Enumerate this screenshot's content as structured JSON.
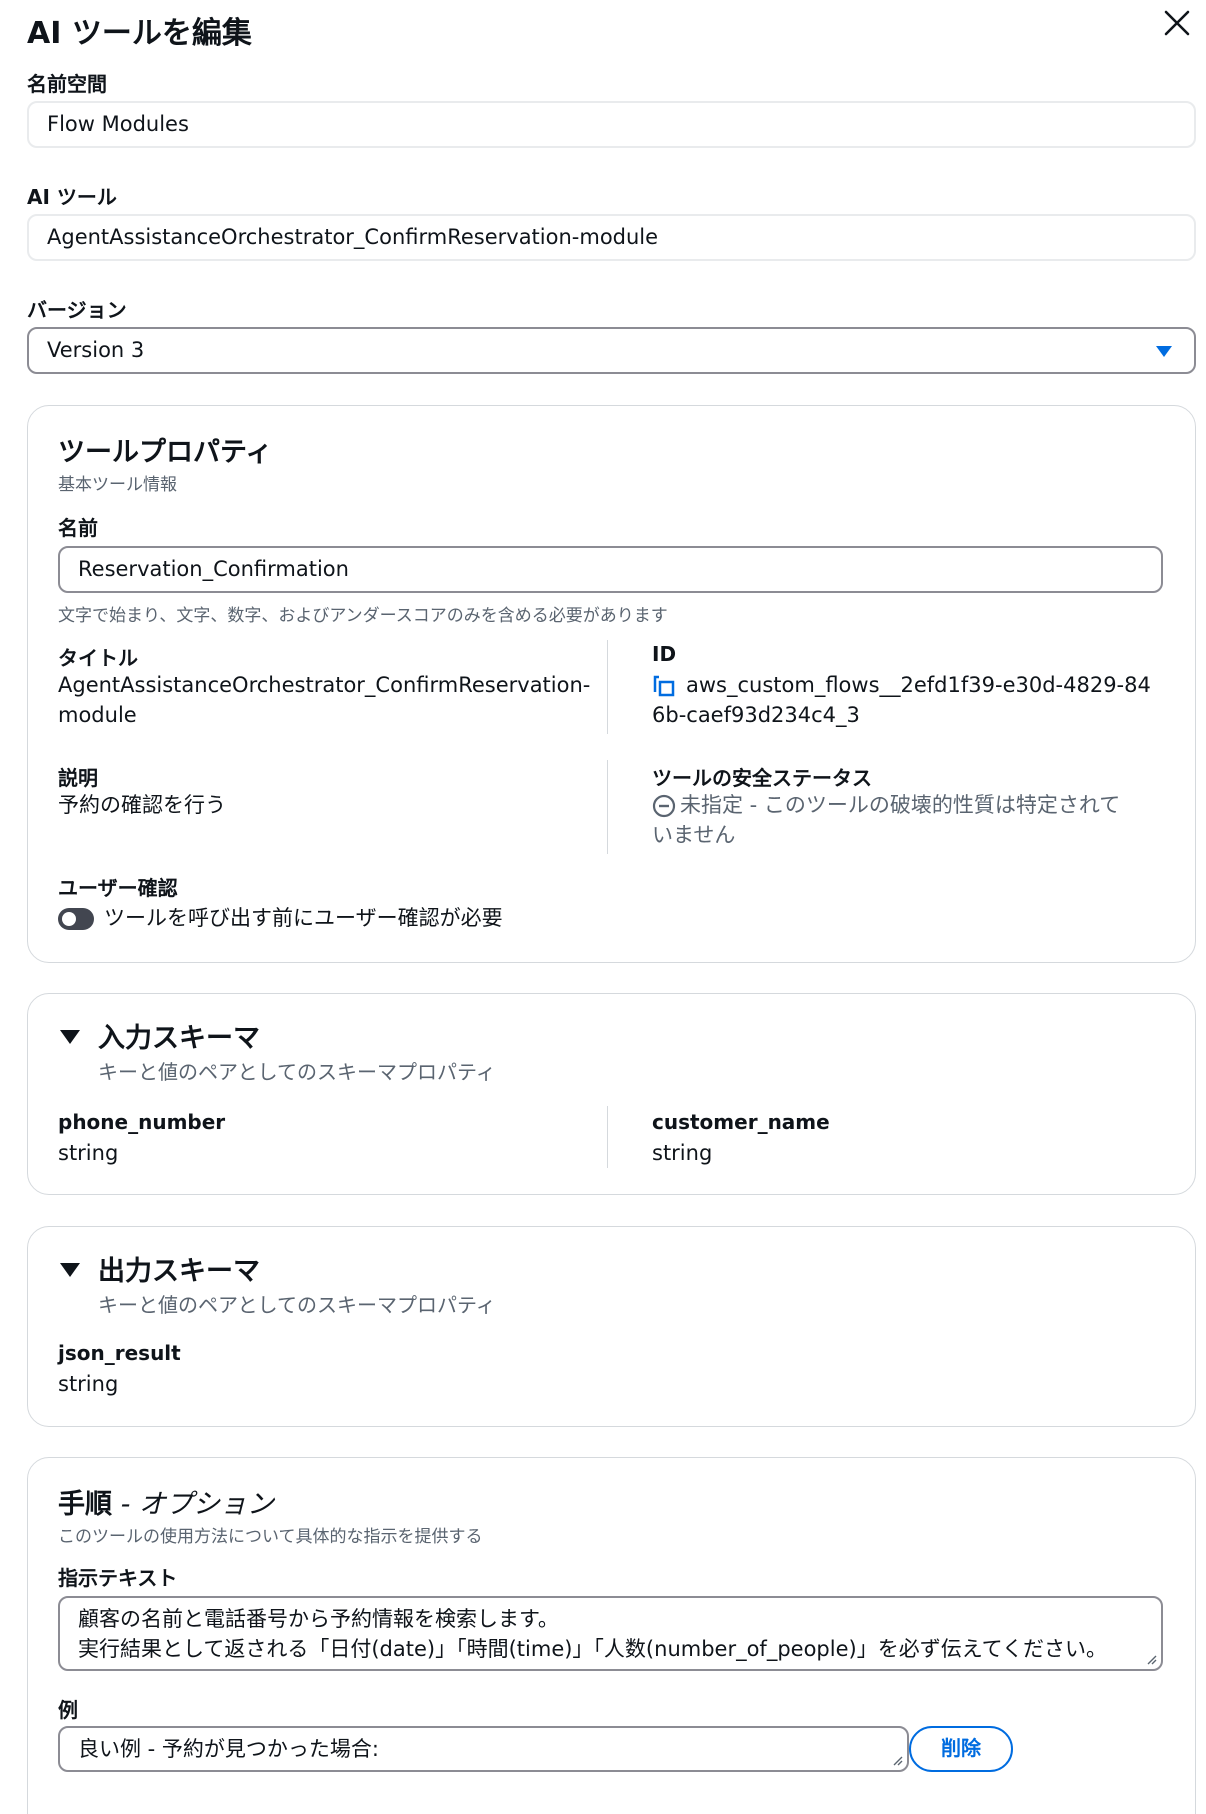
{
  "dialog": {
    "title": "AI ツールを編集"
  },
  "namespace": {
    "label": "名前空間",
    "value": "Flow Modules"
  },
  "ai_tool": {
    "label": "AI ツール",
    "value": "AgentAssistanceOrchestrator_ConfirmReservation-module"
  },
  "version": {
    "label": "バージョン",
    "value": "Version 3"
  },
  "tool_properties": {
    "heading": "ツールプロパティ",
    "subheading": "基本ツール情報",
    "name_label": "名前",
    "name_value": "Reservation_Confirmation",
    "name_hint": "文字で始まり、文字、数字、およびアンダースコアのみを含める必要があります",
    "title_label": "タイトル",
    "title_value_1": "AgentAssistanceOrchestrator_ConfirmReservation-",
    "title_value_2": "module",
    "id_label": "ID",
    "id_value_1": "aws_custom_flows__2efd1f39-e30d-4829-84",
    "id_value_2": "6b-caef93d234c4_3",
    "desc_label": "説明",
    "desc_value": "予約の確認を行う",
    "safety_label": "ツールの安全ステータス",
    "safety_value_1": "未指定 - このツールの破壊的性質は特定されて",
    "safety_value_2": "いません",
    "user_confirm_label": "ユーザー確認",
    "user_confirm_toggle_label": "ツールを呼び出す前にユーザー確認が必要",
    "user_confirm_enabled": false
  },
  "input_schema": {
    "heading": "入力スキーマ",
    "subheading": "キーと値のペアとしてのスキーマプロパティ",
    "props": [
      {
        "key": "phone_number",
        "type": "string"
      },
      {
        "key": "customer_name",
        "type": "string"
      }
    ]
  },
  "output_schema": {
    "heading": "出力スキーマ",
    "subheading": "キーと値のペアとしてのスキーマプロパティ",
    "props": [
      {
        "key": "json_result",
        "type": "string"
      }
    ]
  },
  "instructions": {
    "heading": "手順",
    "optional": " - オプション",
    "subheading": "このツールの使用方法について具体的な指示を提供する",
    "text_label": "指示テキスト",
    "text_line_1": "顧客の名前と電話番号から予約情報を検索します。",
    "text_line_2": "実行結果として返される「日付(date)」「時間(time)」「人数(number_of_people)」を必ず伝えてください。",
    "example_label": "例",
    "example_value": "良い例 - 予約が見つかった場合:",
    "delete_label": "削除"
  }
}
